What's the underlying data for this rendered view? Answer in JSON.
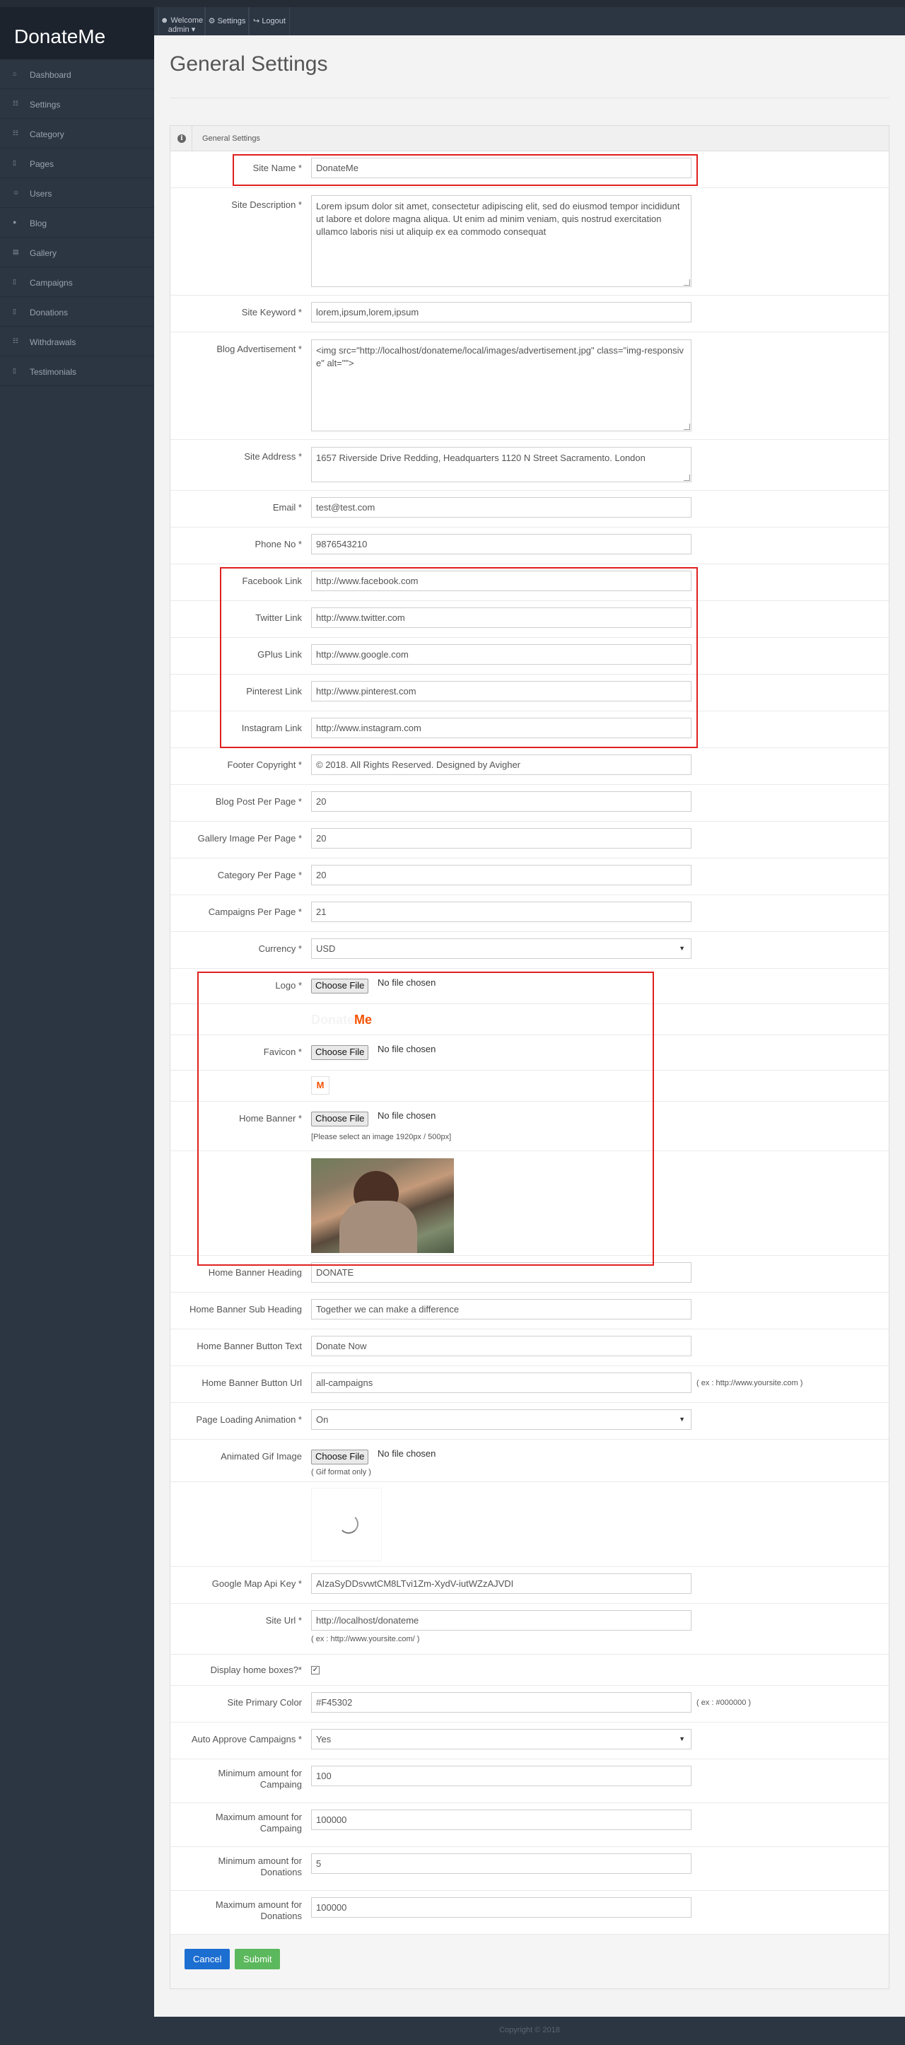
{
  "app": {
    "brand": "DonateMe"
  },
  "topnav": {
    "welcome": "Welcome admin",
    "settings": "Settings",
    "logout": "Logout"
  },
  "sidebar": {
    "items": [
      {
        "label": "Dashboard",
        "icon": "home-icon"
      },
      {
        "label": "Settings",
        "icon": "grid-icon"
      },
      {
        "label": "Category",
        "icon": "grid-icon"
      },
      {
        "label": "Pages",
        "icon": "file-icon"
      },
      {
        "label": "Users",
        "icon": "user-icon"
      },
      {
        "label": "Blog",
        "icon": "comment-icon"
      },
      {
        "label": "Gallery",
        "icon": "folder-icon"
      },
      {
        "label": "Campaigns",
        "icon": "file-icon"
      },
      {
        "label": "Donations",
        "icon": "file-icon"
      },
      {
        "label": "Withdrawals",
        "icon": "grid-icon"
      },
      {
        "label": "Testimonials",
        "icon": "file-icon"
      }
    ]
  },
  "page": {
    "title": "General Settings",
    "panel_title": "General Settings"
  },
  "form": {
    "site_name": {
      "label": "Site Name *",
      "value": "DonateMe"
    },
    "site_description": {
      "label": "Site Description *",
      "value": "Lorem ipsum dolor sit amet, consectetur adipiscing elit, sed do eiusmod tempor incididunt ut labore et dolore magna aliqua. Ut enim ad minim veniam, quis nostrud exercitation ullamco laboris nisi ut aliquip ex ea commodo consequat"
    },
    "site_keyword": {
      "label": "Site Keyword *",
      "value": "lorem,ipsum,lorem,ipsum"
    },
    "blog_advertisement": {
      "label": "Blog Advertisement *",
      "value": "<img src=\"http://localhost/donateme/local/images/advertisement.jpg\" class=\"img-responsive\" alt=\"\">"
    },
    "site_address": {
      "label": "Site Address *",
      "value": "1657 Riverside Drive Redding, Headquarters 1120 N Street Sacramento. London"
    },
    "email": {
      "label": "Email *",
      "value": "test@test.com"
    },
    "phone": {
      "label": "Phone No *",
      "value": "9876543210"
    },
    "facebook": {
      "label": "Facebook Link",
      "value": "http://www.facebook.com"
    },
    "twitter": {
      "label": "Twitter Link",
      "value": "http://www.twitter.com"
    },
    "gplus": {
      "label": "GPlus Link",
      "value": "http://www.google.com"
    },
    "pinterest": {
      "label": "Pinterest Link",
      "value": "http://www.pinterest.com"
    },
    "instagram": {
      "label": "Instagram Link",
      "value": "http://www.instagram.com"
    },
    "footer_copyright": {
      "label": "Footer Copyright *",
      "value": "© 2018. All Rights Reserved. Designed by Avigher"
    },
    "blog_per_page": {
      "label": "Blog Post Per Page *",
      "value": "20"
    },
    "gallery_per_page": {
      "label": "Gallery Image Per Page *",
      "value": "20"
    },
    "category_per_page": {
      "label": "Category Per Page *",
      "value": "20"
    },
    "campaigns_per_page": {
      "label": "Campaigns Per Page *",
      "value": "21"
    },
    "currency": {
      "label": "Currency *",
      "value": "USD"
    },
    "logo": {
      "label": "Logo *",
      "button": "Choose File",
      "status": "No file chosen",
      "preview_a": "Donate",
      "preview_b": "Me"
    },
    "favicon": {
      "label": "Favicon *",
      "button": "Choose File",
      "status": "No file chosen",
      "preview": "M"
    },
    "home_banner": {
      "label": "Home Banner *",
      "button": "Choose File",
      "status": "No file chosen",
      "hint": "[Please select an image 1920px / 500px]"
    },
    "banner_heading": {
      "label": "Home Banner Heading",
      "value": "DONATE"
    },
    "banner_subheading": {
      "label": "Home Banner Sub Heading",
      "value": "Together we can make a difference"
    },
    "banner_button_text": {
      "label": "Home Banner Button Text",
      "value": "Donate Now"
    },
    "banner_button_url": {
      "label": "Home Banner Button Url",
      "value": "all-campaigns",
      "hint": "( ex : http://www.yoursite.com )"
    },
    "loading_animation": {
      "label": "Page Loading Animation *",
      "value": "On"
    },
    "animated_gif": {
      "label": "Animated Gif Image",
      "button": "Choose File",
      "status": "No file chosen",
      "hint": "( Gif format only )"
    },
    "google_map_key": {
      "label": "Google Map Api Key *",
      "value": "AIzaSyDDsvwtCM8LTvi1Zm-XydV-iutWZzAJVDI"
    },
    "site_url": {
      "label": "Site Url *",
      "value": "http://localhost/donateme",
      "hint": "( ex : http://www.yoursite.com/ )"
    },
    "display_home_boxes": {
      "label": "Display home boxes?*"
    },
    "primary_color": {
      "label": "Site Primary Color",
      "value": "#F45302",
      "hint": "( ex : #000000 )"
    },
    "auto_approve": {
      "label": "Auto Approve Campaigns *",
      "value": "Yes"
    },
    "min_campaign": {
      "label": "Minimum amount for Campaing",
      "value": "100"
    },
    "max_campaign": {
      "label": "Maximum amount for Campaing",
      "value": "100000"
    },
    "min_donation": {
      "label": "Minimum amount for Donations",
      "value": "5"
    },
    "max_donation": {
      "label": "Maximum amount for Donations",
      "value": "100000"
    }
  },
  "buttons": {
    "cancel": "Cancel",
    "submit": "Submit"
  },
  "footer": {
    "text": "Copyright © 2018"
  },
  "colors": {
    "accent": "#F45302",
    "cancel": "#1c6ed1",
    "submit": "#5cb85c",
    "highlight": "#e02020"
  }
}
